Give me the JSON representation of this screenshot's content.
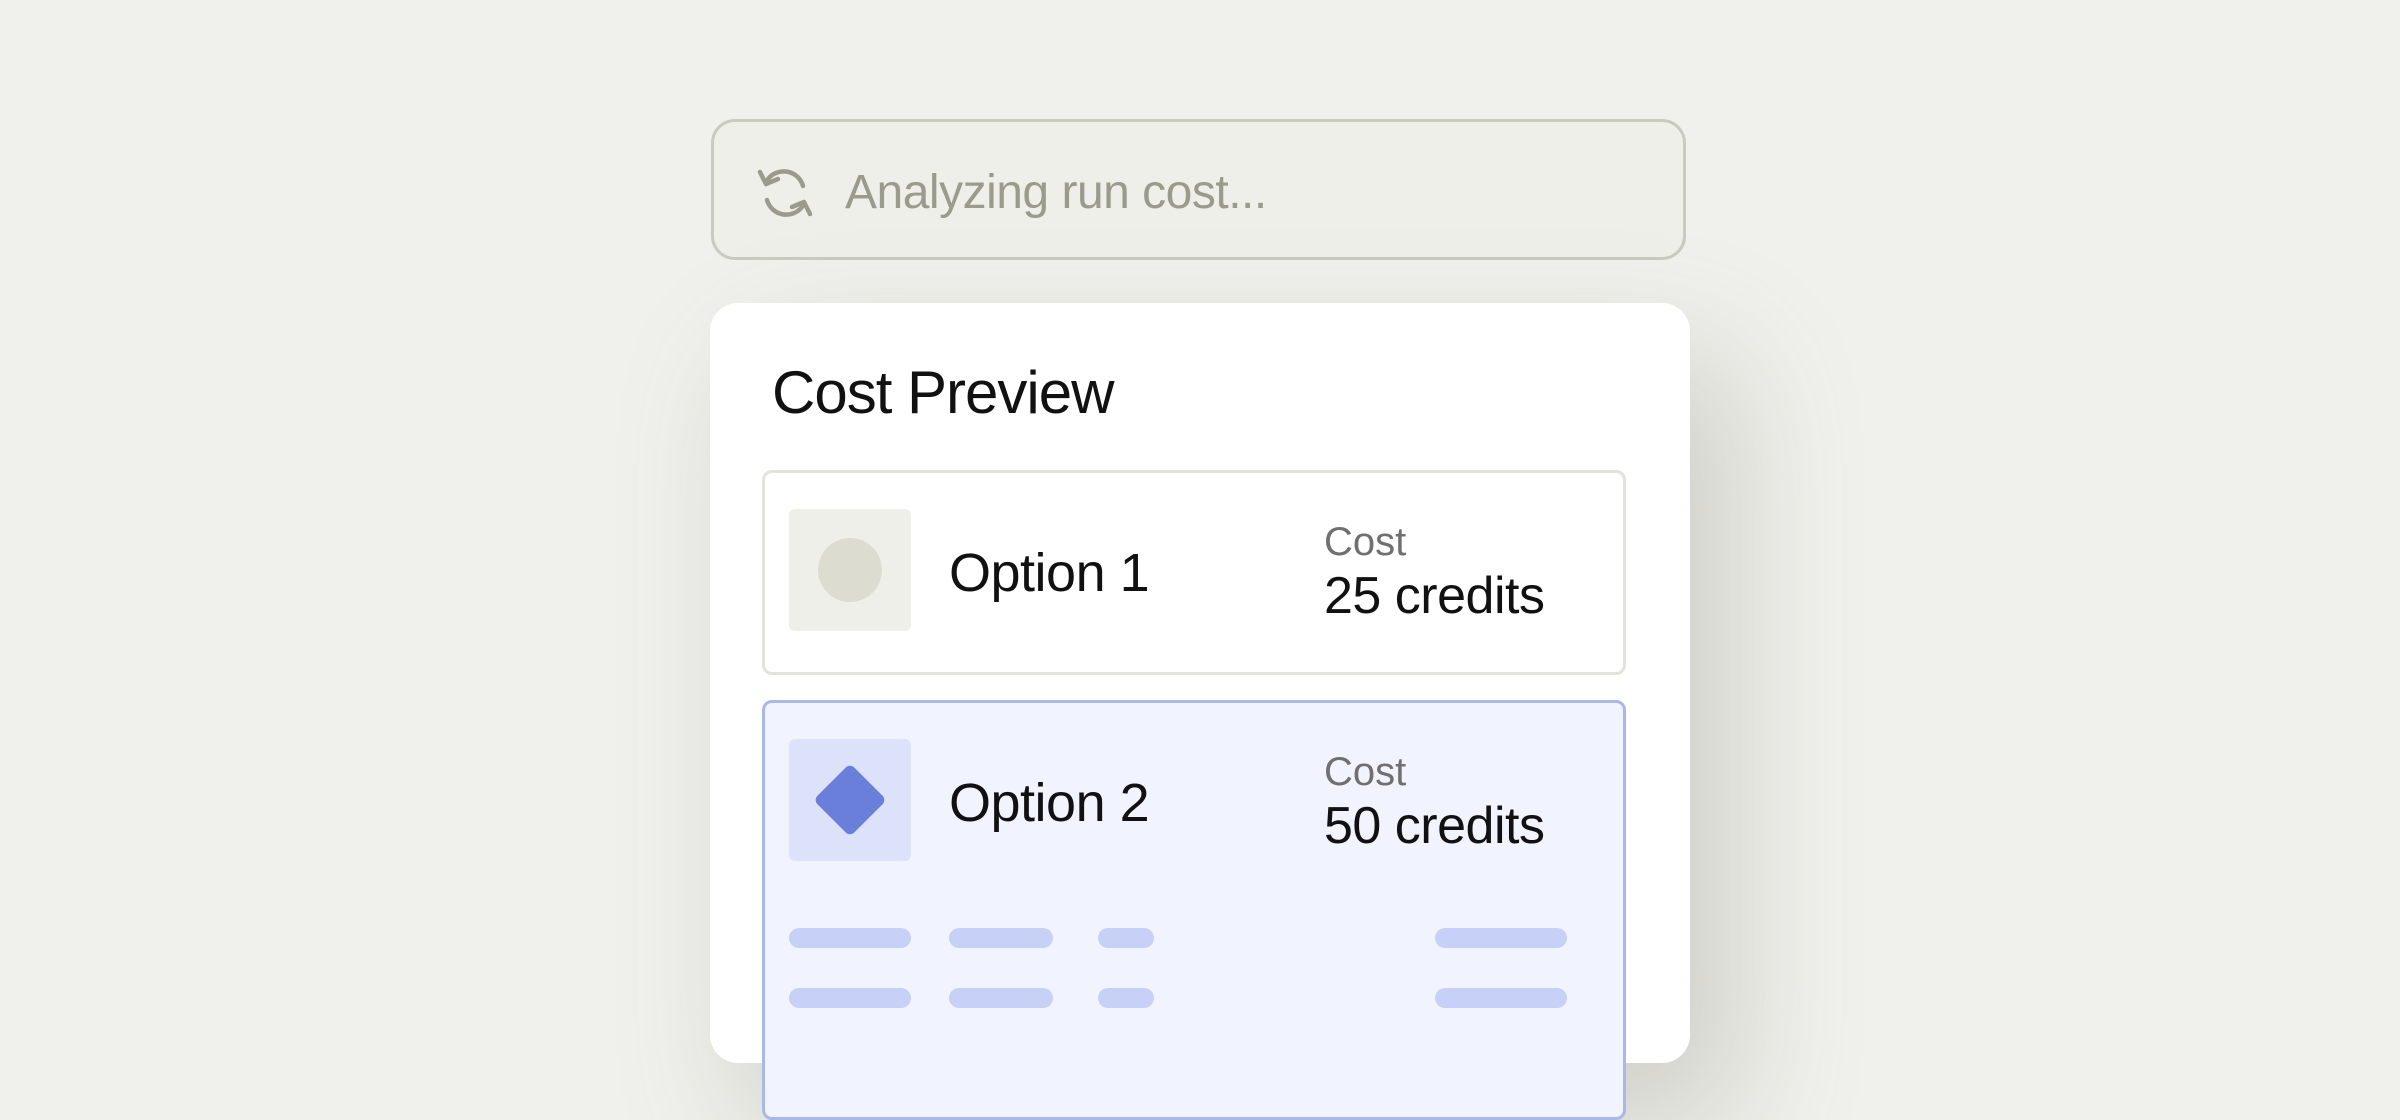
{
  "status": {
    "icon": "refresh-icon",
    "text": "Analyzing run cost..."
  },
  "cost_preview": {
    "title": "Cost Preview",
    "options": [
      {
        "label": "Option 1",
        "icon": "circle-icon",
        "cost_label": "Cost",
        "cost_value": "25 credits",
        "selected": false
      },
      {
        "label": "Option 2",
        "icon": "diamond-icon",
        "cost_label": "Cost",
        "cost_value": "50 credits",
        "selected": true
      }
    ]
  },
  "colors": {
    "background": "#f0f0ec",
    "accent": "#6a7fd9",
    "selected_fill": "#f1f4fe",
    "selected_border": "#aab8e6",
    "skeleton": "#c7d0f7"
  }
}
